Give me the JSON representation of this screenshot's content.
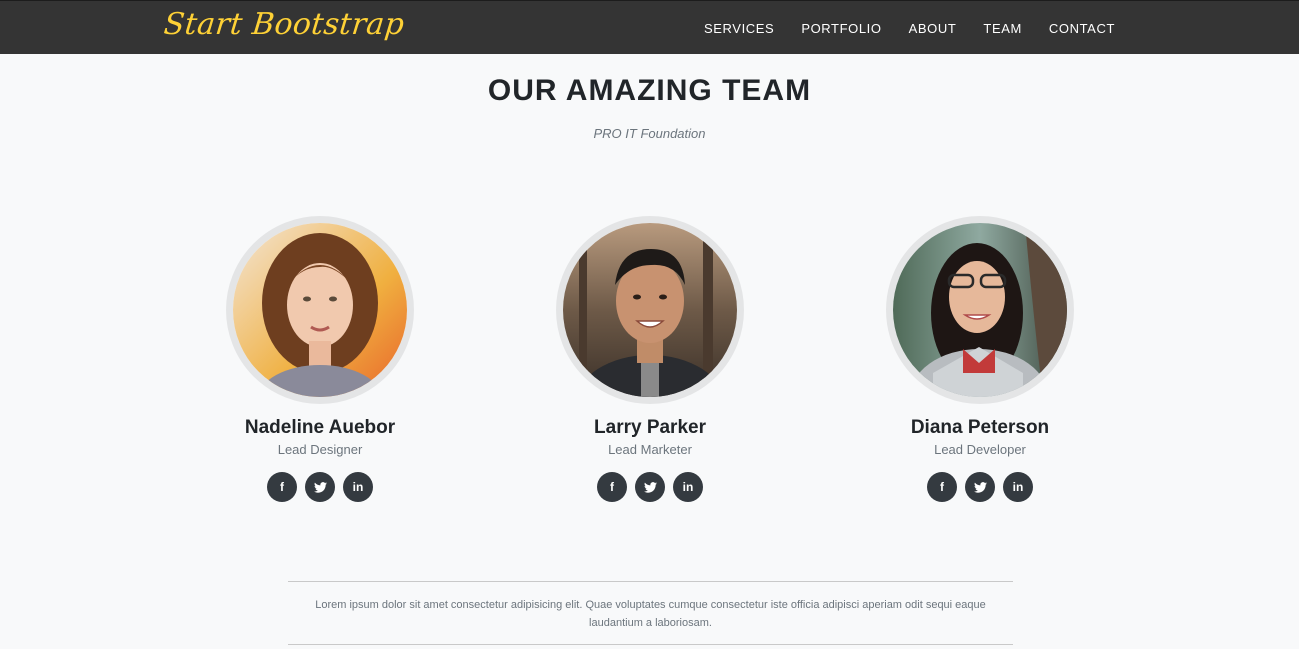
{
  "nav": {
    "brand": "Start Bootstrap",
    "links": [
      "SERVICES",
      "PORTFOLIO",
      "ABOUT",
      "TEAM",
      "CONTACT"
    ]
  },
  "section": {
    "heading": "OUR AMAZING TEAM",
    "subheading": "PRO IT Foundation"
  },
  "team": [
    {
      "name": "Nadeline Auebor",
      "role": "Lead Designer"
    },
    {
      "name": "Larry Parker",
      "role": "Lead Marketer"
    },
    {
      "name": "Diana Peterson",
      "role": "Lead Developer"
    }
  ],
  "social_icons": [
    "f",
    "t",
    "in"
  ],
  "footer_text": "Lorem ipsum dolor sit amet consectetur adipisicing elit. Quae voluptates cumque consectetur iste officia adipisci aperiam odit sequi eaque laudantium a laboriosam.",
  "colors": {
    "navbar": "#343434",
    "brand": "#fed136",
    "social_button": "#343a40",
    "background": "#f8f9fa"
  }
}
